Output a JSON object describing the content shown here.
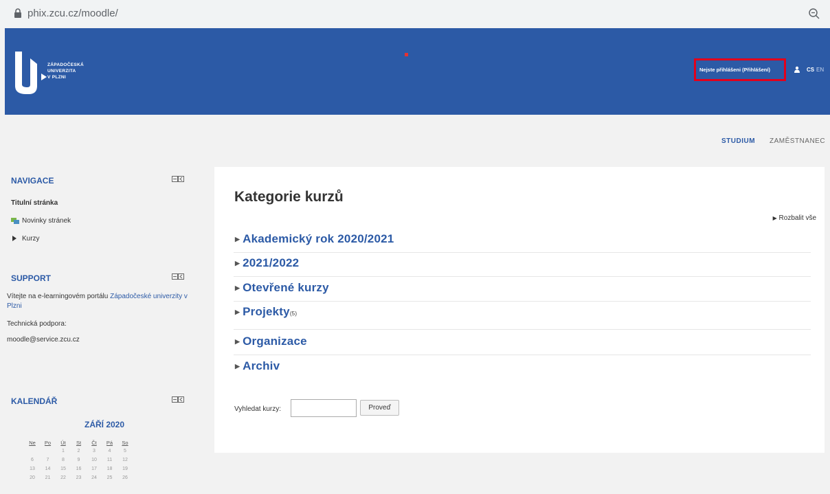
{
  "browser": {
    "url_host": "phix.zcu.cz",
    "url_path": "/moodle/"
  },
  "header": {
    "logo_lines": [
      "ZÁPADOČESKÁ",
      "UNIVERZITA",
      "V PLZNI"
    ],
    "login_text": "Nejste přihlášeni (Přihlášení)",
    "lang_cs": "CS",
    "lang_en": "EN"
  },
  "topnav": {
    "studium": "STUDIUM",
    "zamestnanec": "ZAMĚSTNANEC"
  },
  "navigace": {
    "title": "NAVIGACE",
    "home": "Titulní stránka",
    "news": "Novinky stránek",
    "courses": "Kurzy"
  },
  "support": {
    "title": "SUPPORT",
    "intro": "Vítejte na e-learningovém portálu ",
    "link": "Západočeské univerzity v Plzni",
    "tech_label": "Technická podpora:",
    "email": "moodle@service.zcu.cz"
  },
  "calendar": {
    "title": "KALENDÁŘ",
    "month": "ZÁŘÍ 2020",
    "weekdays": [
      "Ne",
      "Po",
      "Út",
      "St",
      "Čt",
      "Pá",
      "So"
    ],
    "weeks": [
      [
        "",
        "",
        "1",
        "2",
        "3",
        "4",
        "5"
      ],
      [
        "6",
        "7",
        "8",
        "9",
        "10",
        "11",
        "12"
      ],
      [
        "13",
        "14",
        "15",
        "16",
        "17",
        "18",
        "19"
      ],
      [
        "20",
        "21",
        "22",
        "23",
        "24",
        "25",
        "26"
      ]
    ]
  },
  "main": {
    "title": "Kategorie kurzů",
    "expand_all": "Rozbalit vše",
    "categories": [
      {
        "name": "Akademický rok 2020/2021",
        "count": ""
      },
      {
        "name": "2021/2022",
        "count": ""
      },
      {
        "name": "Otevřené kurzy",
        "count": ""
      },
      {
        "name": "Projekty",
        "count": "(5)"
      },
      {
        "name": "Organizace",
        "count": ""
      },
      {
        "name": "Archiv",
        "count": ""
      }
    ],
    "search_label": "Vyhledat kurzy:",
    "search_value": "",
    "search_button": "Proveď"
  }
}
